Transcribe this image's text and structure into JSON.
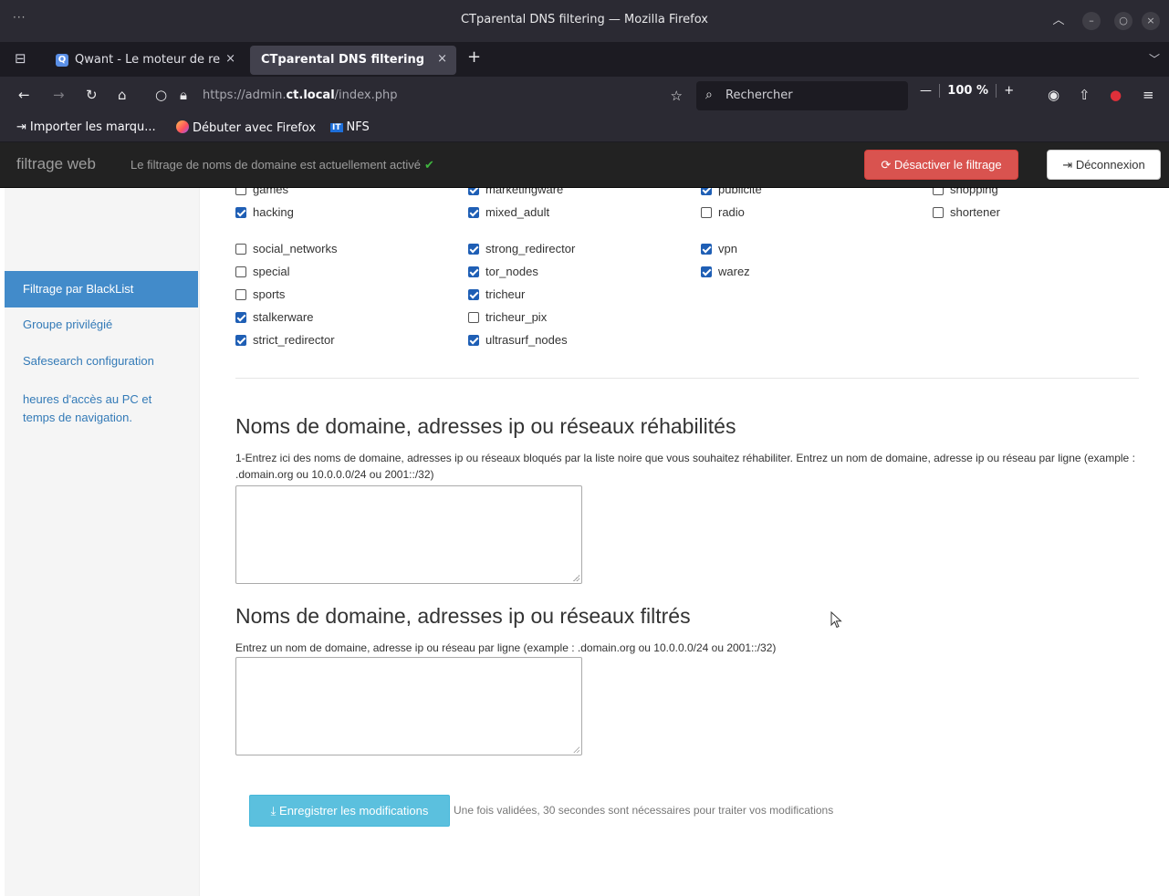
{
  "window": {
    "title": "CTparental DNS filtering — Mozilla Firefox"
  },
  "tabs": [
    {
      "label": "Qwant - Le moteur de re",
      "favicon_text": "Q"
    },
    {
      "label": "CTparental DNS filtering"
    }
  ],
  "navbar": {
    "url_prefix": "https://admin.",
    "url_host": "ct.local",
    "url_suffix": "/index.php",
    "search_placeholder": "Rechercher",
    "zoom": "100 %"
  },
  "bookmarks": [
    {
      "label": "Importer les marqu..."
    },
    {
      "label": "Débuter avec Firefox"
    },
    {
      "label": "NFS",
      "badge": "IT"
    }
  ],
  "app": {
    "brand": "filtrage web",
    "status_text": "Le filtrage de noms de domaine est actuellement activé",
    "disable_button": "Désactiver le filtrage",
    "logout_button": "Déconnexion"
  },
  "sidebar": {
    "items": [
      {
        "label": "Filtrage par BlackList",
        "active": true
      },
      {
        "label": "Groupe privilégié"
      },
      {
        "label": "Safesearch configuration"
      },
      {
        "label": "heures d'accès au PC et temps de navigation."
      }
    ]
  },
  "blacklist": {
    "categories": [
      {
        "name": "games",
        "checked": false
      },
      {
        "name": "marketingware",
        "checked": true
      },
      {
        "name": "publicite",
        "checked": true
      },
      {
        "name": "shopping",
        "checked": false
      },
      {
        "name": "hacking",
        "checked": true
      },
      {
        "name": "mixed_adult",
        "checked": true
      },
      {
        "name": "radio",
        "checked": false
      },
      {
        "name": "shortener",
        "checked": false
      },
      {
        "name": "social_networks",
        "checked": false
      },
      {
        "name": "strong_redirector",
        "checked": true
      },
      {
        "name": "vpn",
        "checked": true
      },
      {
        "name": "special",
        "checked": false
      },
      {
        "name": "tor_nodes",
        "checked": true
      },
      {
        "name": "warez",
        "checked": true
      },
      {
        "name": "sports",
        "checked": false
      },
      {
        "name": "tricheur",
        "checked": true
      },
      {
        "name": "stalkerware",
        "checked": true
      },
      {
        "name": "tricheur_pix",
        "checked": false
      },
      {
        "name": "strict_redirector",
        "checked": true
      },
      {
        "name": "ultrasurf_nodes",
        "checked": true
      }
    ]
  },
  "whitelist_section": {
    "title": "Noms de domaine, adresses ip ou réseaux réhabilités",
    "help": "1-Entrez ici des noms de domaine, adresses ip ou réseaux bloqués par la liste noire que vous souhaitez réhabiliter. Entrez un nom de domaine, adresse ip ou réseau par ligne (example : .domain.org ou 10.0.0.0/24 ou 2001::/32)",
    "value": ""
  },
  "filtered_section": {
    "title": "Noms de domaine, adresses ip ou réseaux filtrés",
    "help": "Entrez un nom de domaine, adresse ip ou réseau par ligne (example : .domain.org ou 10.0.0.0/24 ou 2001::/32)",
    "value": ""
  },
  "save": {
    "button": "Enregistrer les modifications",
    "note": "Une fois validées, 30 secondes sont nécessaires pour traiter vos modifications"
  }
}
